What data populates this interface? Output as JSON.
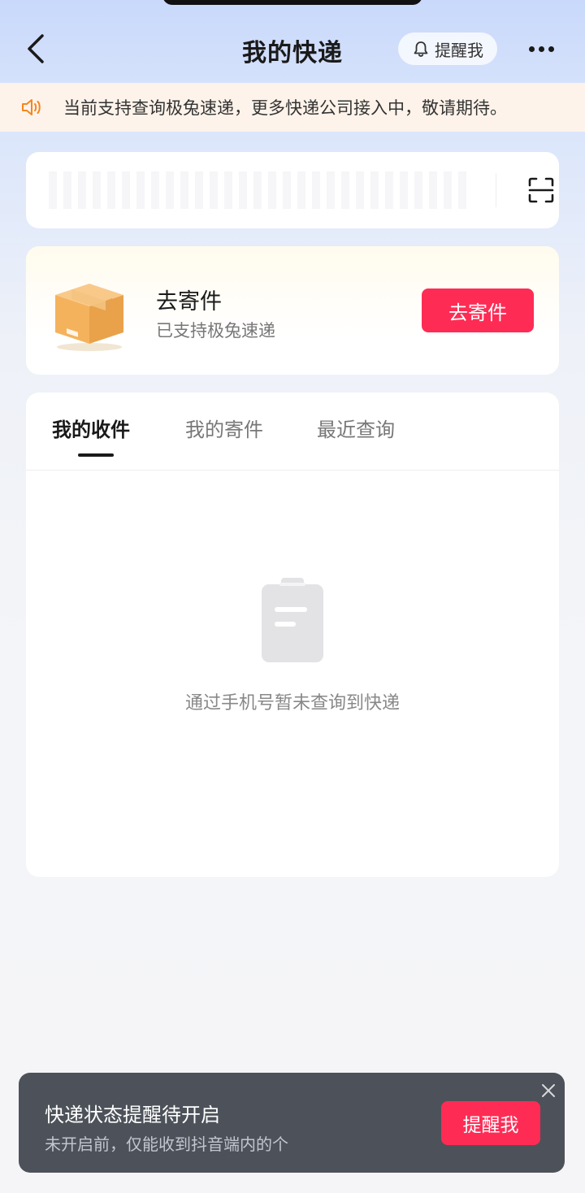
{
  "header": {
    "title": "我的快递",
    "remind_label": "提醒我",
    "back_icon": "chevron-left-icon",
    "more_icon": "more-dots-icon"
  },
  "notice": {
    "text": "当前支持查询极兔速递，更多快递公司接入中，敬请期待。",
    "icon": "speaker-icon",
    "icon_color": "#f5861f"
  },
  "search": {
    "placeholder": "",
    "scan_icon": "scan-icon"
  },
  "send_card": {
    "title": "去寄件",
    "subtitle": "已支持极兔速递",
    "button_label": "去寄件",
    "icon": "package-box-icon"
  },
  "tabs": [
    {
      "label": "我的收件",
      "active": true
    },
    {
      "label": "我的寄件",
      "active": false
    },
    {
      "label": "最近查询",
      "active": false
    }
  ],
  "empty_state": {
    "icon": "clipboard-icon",
    "text": "通过手机号暂未查询到快递"
  },
  "toast": {
    "title": "快递状态提醒待开启",
    "subtitle": "未开启前，仅能收到抖音端内的个",
    "button_label": "提醒我",
    "close_icon": "close-icon"
  },
  "colors": {
    "accent": "#fe2c55",
    "toast_bg": "#4d525a",
    "notice_bg": "#fdf3ea"
  }
}
